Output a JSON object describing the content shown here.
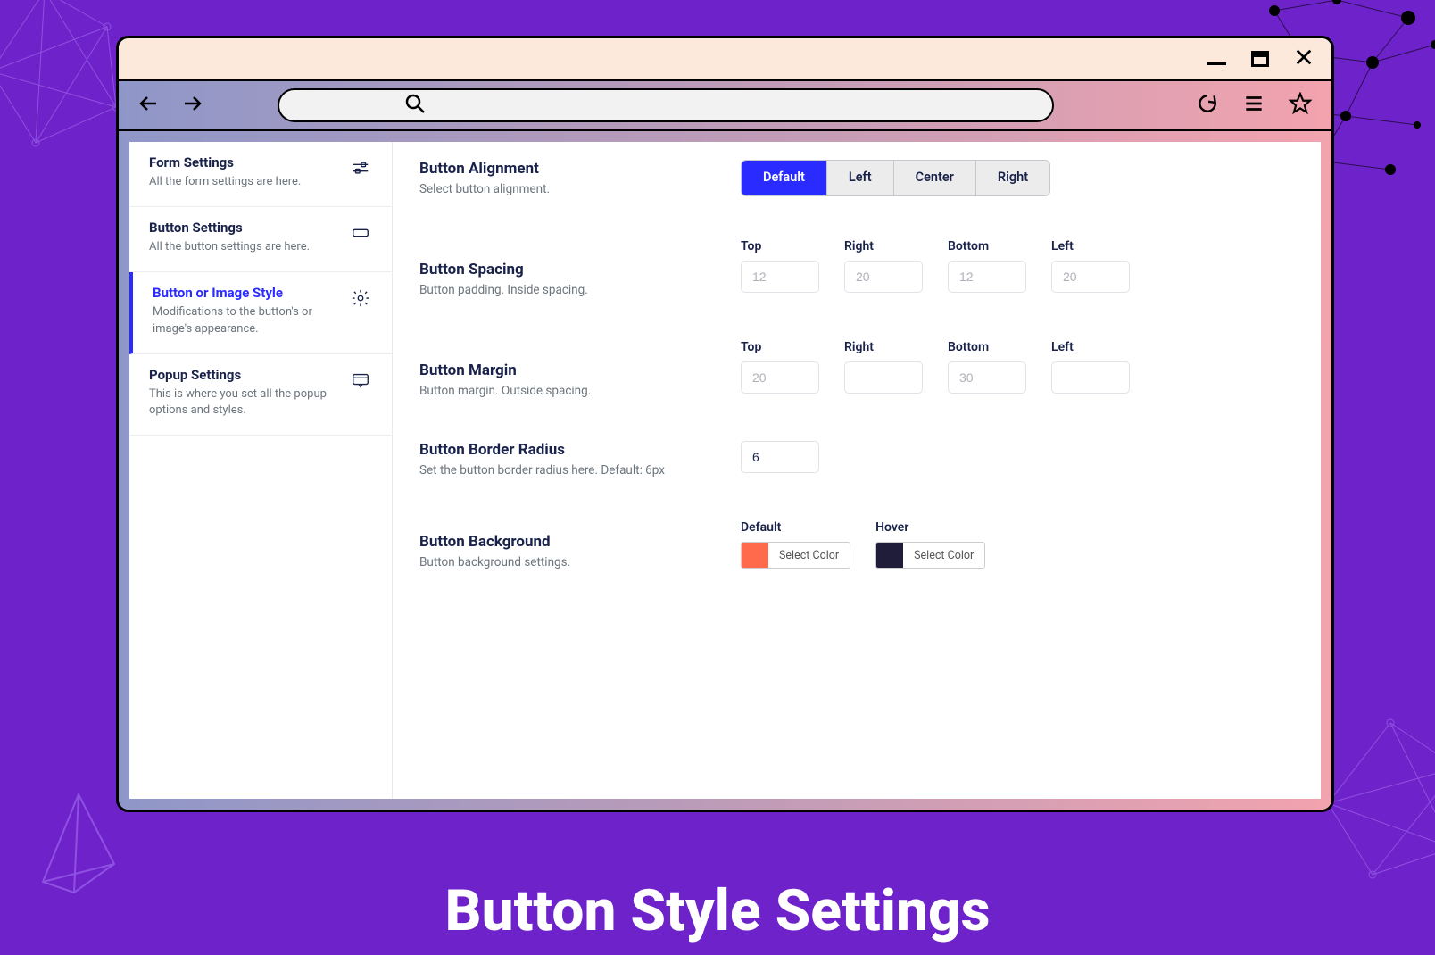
{
  "page_title": "Button Style Settings",
  "sidebar": {
    "items": [
      {
        "title": "Form Settings",
        "desc": "All the form settings are here.",
        "active": false
      },
      {
        "title": "Button Settings",
        "desc": "All the button settings are here.",
        "active": false
      },
      {
        "title": "Button or Image Style",
        "desc": "Modifications to the button's or image's appearance.",
        "active": true
      },
      {
        "title": "Popup Settings",
        "desc": "This is where you set all the popup options and styles.",
        "active": false
      }
    ]
  },
  "settings": {
    "alignment": {
      "title": "Button Alignment",
      "desc": "Select button alignment.",
      "options": [
        "Default",
        "Left",
        "Center",
        "Right"
      ],
      "selected": "Default"
    },
    "spacing": {
      "title": "Button Spacing",
      "desc": "Button padding. Inside spacing.",
      "fields": {
        "top": {
          "label": "Top",
          "placeholder": "12",
          "value": ""
        },
        "right": {
          "label": "Right",
          "placeholder": "20",
          "value": ""
        },
        "bottom": {
          "label": "Bottom",
          "placeholder": "12",
          "value": ""
        },
        "left": {
          "label": "Left",
          "placeholder": "20",
          "value": ""
        }
      }
    },
    "margin": {
      "title": "Button Margin",
      "desc": "Button margin. Outside spacing.",
      "fields": {
        "top": {
          "label": "Top",
          "placeholder": "20",
          "value": ""
        },
        "right": {
          "label": "Right",
          "placeholder": "",
          "value": ""
        },
        "bottom": {
          "label": "Bottom",
          "placeholder": "30",
          "value": ""
        },
        "left": {
          "label": "Left",
          "placeholder": "",
          "value": ""
        }
      }
    },
    "radius": {
      "title": "Button Border Radius",
      "desc": "Set the button border radius here. Default: 6px",
      "value": "6"
    },
    "background": {
      "title": "Button Background",
      "desc": "Button background settings.",
      "default": {
        "label": "Default",
        "swatch": "#ff6a4c",
        "button": "Select Color"
      },
      "hover": {
        "label": "Hover",
        "swatch": "#1f1d3a",
        "button": "Select Color"
      }
    }
  }
}
